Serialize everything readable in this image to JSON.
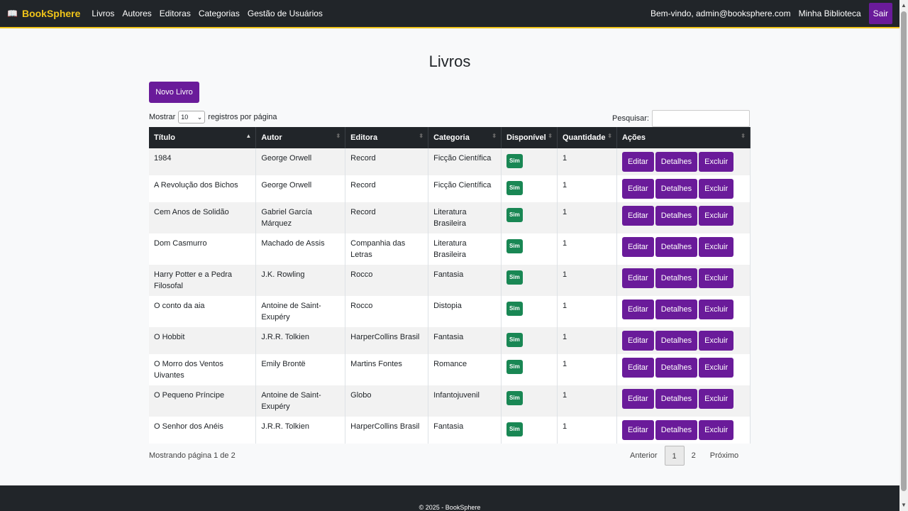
{
  "nav": {
    "brand": "BookSphere",
    "links": [
      "Livros",
      "Autores",
      "Editoras",
      "Categorias",
      "Gestão de Usuários"
    ],
    "welcome": "Bem-vindo, admin@booksphere.com",
    "my_library": "Minha Biblioteca",
    "logout": "Sair"
  },
  "page": {
    "title": "Livros",
    "new_button": "Novo Livro",
    "show_label": "Mostrar",
    "page_size": "10",
    "per_page_label": "registros por página",
    "search_label": "Pesquisar:"
  },
  "table": {
    "headers": [
      "Título",
      "Autor",
      "Editora",
      "Categoria",
      "Disponível",
      "Quantidade",
      "Ações"
    ],
    "rows": [
      {
        "title": "1984",
        "author": "George Orwell",
        "publisher": "Record",
        "category": "Ficção Científica",
        "available": "Sim",
        "quantity": "1"
      },
      {
        "title": "A Revolução dos Bichos",
        "author": "George Orwell",
        "publisher": "Record",
        "category": "Ficção Científica",
        "available": "Sim",
        "quantity": "1"
      },
      {
        "title": "Cem Anos de Solidão",
        "author": "Gabriel García Márquez",
        "publisher": "Record",
        "category": "Literatura Brasileira",
        "available": "Sim",
        "quantity": "1"
      },
      {
        "title": "Dom Casmurro",
        "author": "Machado de Assis",
        "publisher": "Companhia das Letras",
        "category": "Literatura Brasileira",
        "available": "Sim",
        "quantity": "1"
      },
      {
        "title": "Harry Potter e a Pedra Filosofal",
        "author": "J.K. Rowling",
        "publisher": "Rocco",
        "category": "Fantasia",
        "available": "Sim",
        "quantity": "1"
      },
      {
        "title": "O conto da aia",
        "author": "Antoine de Saint-Exupéry",
        "publisher": "Rocco",
        "category": "Distopia",
        "available": "Sim",
        "quantity": "1"
      },
      {
        "title": "O Hobbit",
        "author": "J.R.R. Tolkien",
        "publisher": "HarperCollins Brasil",
        "category": "Fantasia",
        "available": "Sim",
        "quantity": "1"
      },
      {
        "title": "O Morro dos Ventos Uivantes",
        "author": "Emily Brontë",
        "publisher": "Martins Fontes",
        "category": "Romance",
        "available": "Sim",
        "quantity": "1"
      },
      {
        "title": "O Pequeno Príncipe",
        "author": "Antoine de Saint-Exupéry",
        "publisher": "Globo",
        "category": "Infantojuvenil",
        "available": "Sim",
        "quantity": "1"
      },
      {
        "title": "O Senhor dos Anéis",
        "author": "J.R.R. Tolkien",
        "publisher": "HarperCollins Brasil",
        "category": "Fantasia",
        "available": "Sim",
        "quantity": "1"
      }
    ],
    "actions": {
      "edit": "Editar",
      "details": "Detalhes",
      "delete": "Excluir"
    }
  },
  "pagination": {
    "info": "Mostrando página 1 de 2",
    "previous": "Anterior",
    "pages": [
      "1",
      "2"
    ],
    "next": "Próximo"
  },
  "footer": {
    "text": "© 2025 - BookSphere"
  },
  "colors": {
    "primary": "#6a1b9a",
    "navbar": "#212529",
    "accent": "#f0c419",
    "badge": "#198754"
  },
  "icons": {
    "brand": "book-icon",
    "sort": "sort-arrows-icon"
  }
}
